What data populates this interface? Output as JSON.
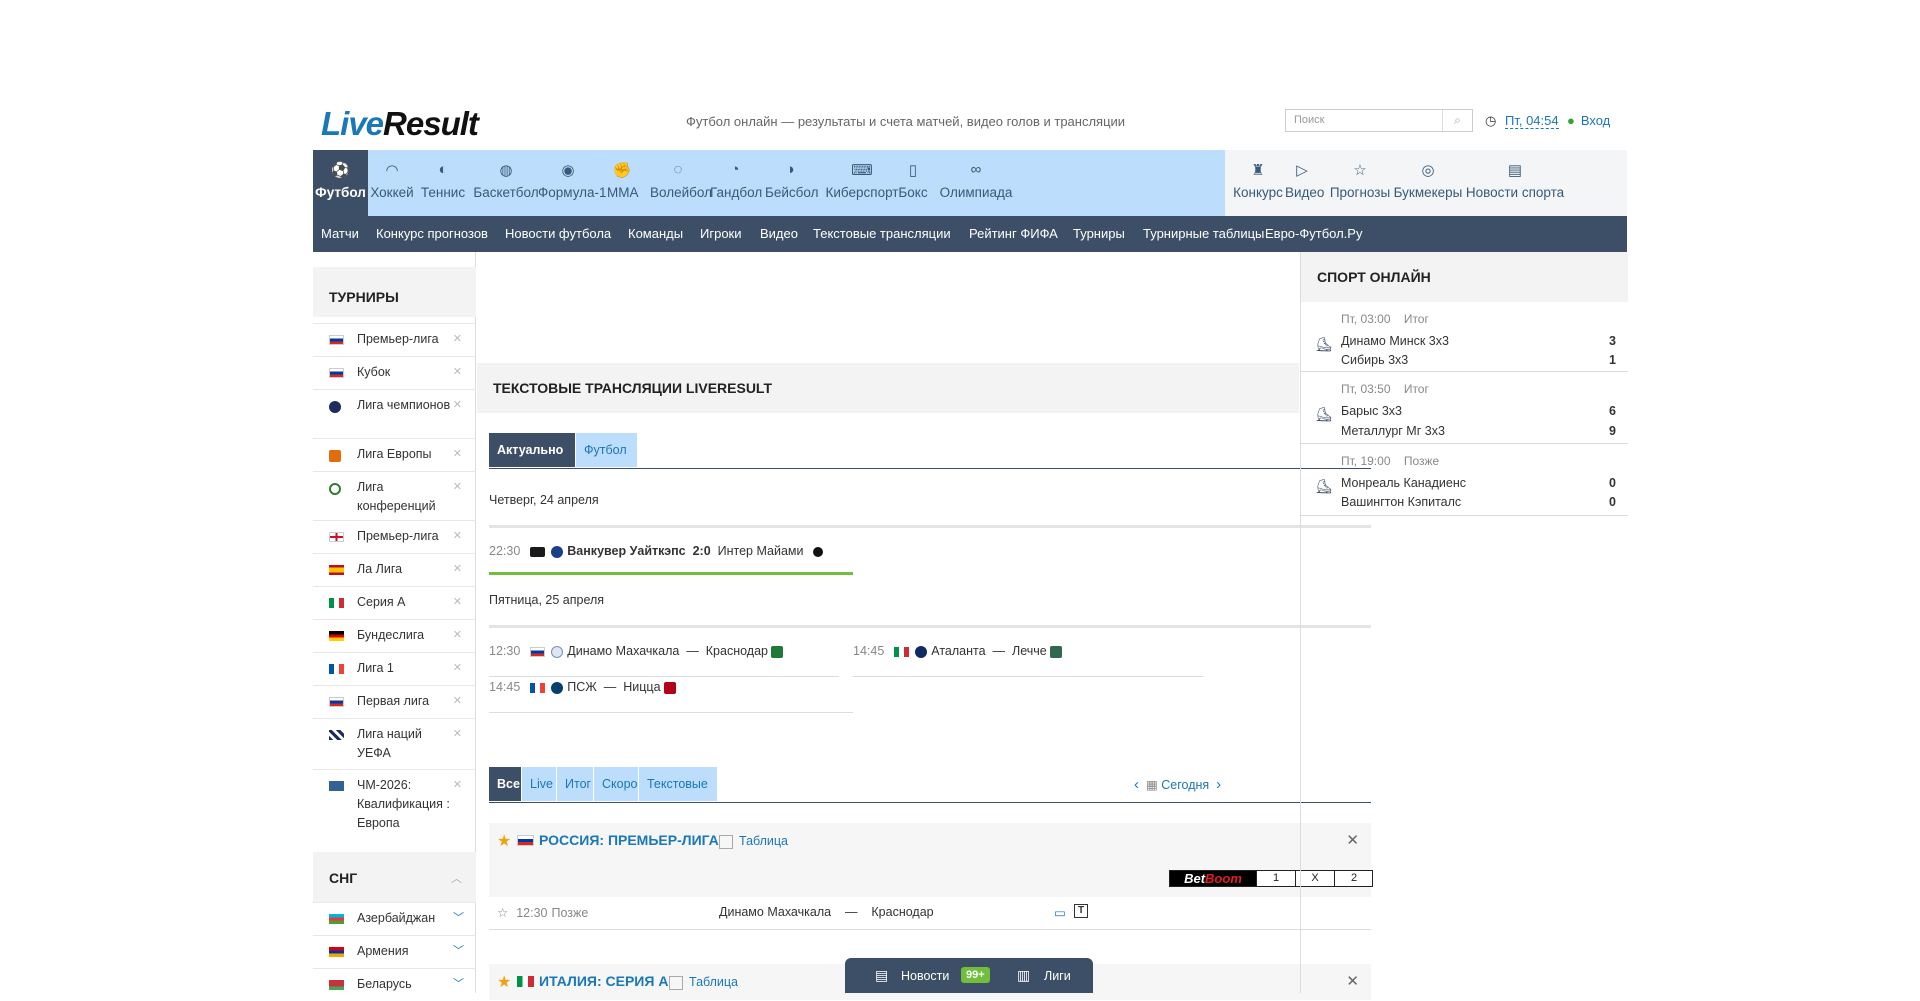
{
  "header": {
    "logo_part1": "Live",
    "logo_part2": "Result",
    "tagline": "Футбол онлайн — результаты и счета матчей, видео голов и трансляции",
    "search_placeholder": "Поиск",
    "time": "Пт, 04:54",
    "login": "Вход"
  },
  "sports_nav": [
    {
      "label": "Футбол",
      "icon": "football-icon",
      "active": true
    },
    {
      "label": "Хоккей",
      "icon": "hockey-icon"
    },
    {
      "label": "Теннис",
      "icon": "tennis-icon"
    },
    {
      "label": "Баскетбол",
      "icon": "basketball-icon"
    },
    {
      "label": "Формула-1",
      "icon": "formula1-icon"
    },
    {
      "label": "ММА",
      "icon": "mma-icon"
    },
    {
      "label": "Волейбол",
      "icon": "volleyball-icon"
    },
    {
      "label": "Гандбол",
      "icon": "handball-icon"
    },
    {
      "label": "Бейсбол",
      "icon": "baseball-icon"
    },
    {
      "label": "Киберспорт",
      "icon": "gamepad-icon"
    },
    {
      "label": "Бокс",
      "icon": "boxing-icon"
    },
    {
      "label": "Олимпиада",
      "icon": "olympic-rings-icon"
    },
    {
      "label": "Конкурс",
      "icon": "trophy-icon"
    },
    {
      "label": "Видео",
      "icon": "play-icon"
    },
    {
      "label": "Прогнозы",
      "icon": "star-icon"
    },
    {
      "label": "Букмекеры",
      "icon": "coins-icon"
    },
    {
      "label": "Новости спорта",
      "icon": "newspaper-icon"
    }
  ],
  "sub_nav": [
    "Матчи",
    "Конкурс прогнозов",
    "Новости футбола",
    "Команды",
    "Игроки",
    "Видео",
    "Текстовые трансляции",
    "Рейтинг ФИФА",
    "Турниры",
    "Турнирные таблицы",
    "Евро-Футбол.Ру"
  ],
  "left": {
    "tournaments_title": "ТУРНИРЫ",
    "tournaments": [
      {
        "name": "Премьер-лига",
        "flag": "russia"
      },
      {
        "name": "Кубок",
        "flag": "russia"
      },
      {
        "name": "Лига чемпионов",
        "flag": "ucl"
      },
      {
        "name": "Лига Европы",
        "flag": "uel"
      },
      {
        "name": "Лига конференций",
        "flag": "uecl"
      },
      {
        "name": "Премьер-лига",
        "flag": "england"
      },
      {
        "name": "Ла Лига",
        "flag": "spain"
      },
      {
        "name": "Серия А",
        "flag": "italy"
      },
      {
        "name": "Бундеслига",
        "flag": "germany"
      },
      {
        "name": "Лига 1",
        "flag": "france"
      },
      {
        "name": "Первая лига",
        "flag": "russia"
      },
      {
        "name": "Лига наций УЕФА",
        "flag": "uefa"
      },
      {
        "name": "ЧМ-2026: Квалификация : Европа",
        "flag": "fifa"
      }
    ],
    "cis_title": "СНГ",
    "cis": [
      {
        "name": "Азербайджан",
        "flag": "azerbaijan"
      },
      {
        "name": "Армения",
        "flag": "armenia"
      },
      {
        "name": "Беларусь",
        "flag": "belarus"
      }
    ]
  },
  "center": {
    "section_title": "ТЕКСТОВЫЕ ТРАНСЛЯЦИИ LIVERESULT",
    "tabs": [
      "Актуально",
      "Футбол"
    ],
    "day1": "Четверг, 24 апреля",
    "live_match": {
      "time": "22:30",
      "home": "Ванкувер Уайткэпс",
      "score": "2:0",
      "away": "Интер Майами"
    },
    "day2": "Пятница, 25 апреля",
    "matches": [
      {
        "time": "12:30",
        "home": "Динамо Махачкала",
        "sep": "—",
        "away": "Краснодар",
        "flag": "russia"
      },
      {
        "time": "14:45",
        "home": "Аталанта",
        "sep": "—",
        "away": "Лечче",
        "flag": "italy"
      },
      {
        "time": "14:45",
        "home": "ПСЖ",
        "sep": "—",
        "away": "Ницца",
        "flag": "france"
      }
    ],
    "filter_tabs": [
      "Все",
      "Live",
      "Итог",
      "Скоро",
      "Текстовые"
    ],
    "today": "Сегодня",
    "leagues": [
      {
        "name": "РОССИЯ: ПРЕМЬЕР-ЛИГА",
        "table": "Таблица",
        "flag": "russia"
      },
      {
        "name": "ИТАЛИЯ: СЕРИЯ А",
        "table": "Таблица",
        "flag": "italy"
      }
    ],
    "odds": {
      "brand_a": "Bet",
      "brand_b": "Boom",
      "c1": "1",
      "cx": "X",
      "c2": "2"
    },
    "row": {
      "time": "12:30",
      "status": "Позже",
      "home": "Динамо Махачкала",
      "sep": "—",
      "away": "Краснодар"
    }
  },
  "right": {
    "title": "СПОРТ ОНЛАЙН",
    "games": [
      {
        "status": "Пт, 03:00    Итог",
        "home": "Динамо Минск 3х3",
        "home_score": "3",
        "away": "Сибирь 3х3",
        "away_score": "1"
      },
      {
        "status": "Пт, 03:50    Итог",
        "home": "Барыс 3х3",
        "home_score": "6",
        "away": "Металлург Мг 3х3",
        "away_score": "9"
      },
      {
        "status": "Пт, 19:00    Позже",
        "home": "Монреаль Канадиенс",
        "home_score": "0",
        "away": "Вашингтон Кэпиталс",
        "away_score": "0"
      }
    ]
  },
  "bottom_bar": {
    "news": "Новости",
    "badge": "99+",
    "leagues": "Лиги"
  },
  "colors": {
    "accent": "#1a77b8",
    "nav_bg": "#bdddfc",
    "dark": "#3d4f66",
    "live_green": "#6fbf3a"
  }
}
